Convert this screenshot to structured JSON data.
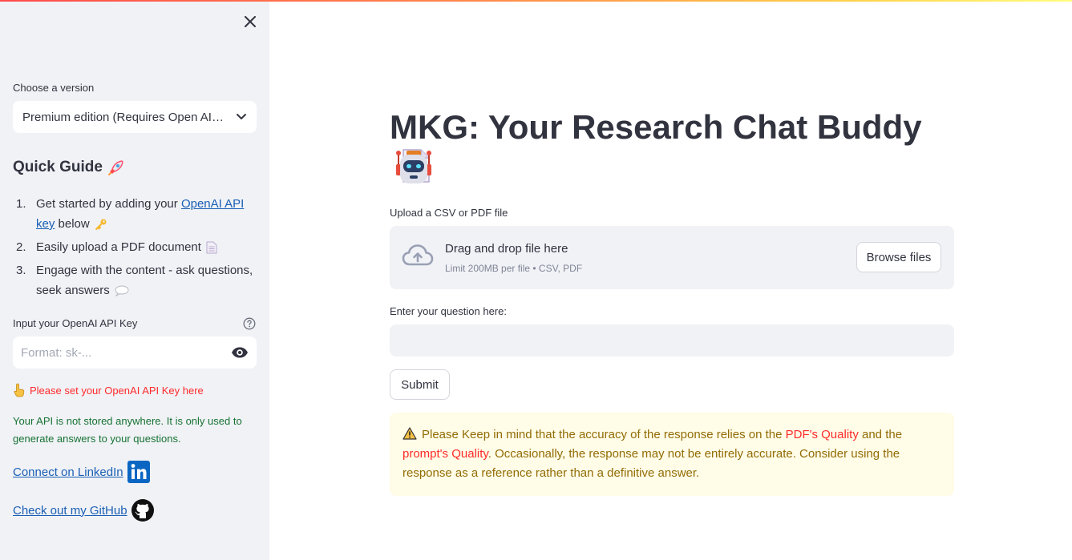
{
  "sidebar": {
    "version_label": "Choose a version",
    "version_selected": "Premium edition (Requires Open AI API)",
    "quick_guide_title": "Quick Guide",
    "guide": [
      {
        "num": "1.",
        "pre": "Get started by adding your ",
        "link": "OpenAI API key",
        "post": " below"
      },
      {
        "num": "2.",
        "text": "Easily upload a PDF document"
      },
      {
        "num": "3.",
        "text": "Engage with the content - ask questions, seek answers"
      }
    ],
    "api_label": "Input your OpenAI API Key",
    "api_placeholder": "Format: sk-...",
    "api_warning": "Please set your OpenAI API Key here",
    "api_info": "Your API is not stored anywhere. It is only used to generate answers to your questions.",
    "linkedin_text": "Connect on LinkedIn",
    "github_text": "Check out my GitHub"
  },
  "main": {
    "title": "MKG: Your Research Chat Buddy",
    "upload_label": "Upload a CSV or PDF file",
    "dropzone_text": "Drag and drop file here",
    "dropzone_limit": "Limit 200MB per file • CSV, PDF",
    "browse_label": "Browse files",
    "question_label": "Enter your question here:",
    "question_value": "",
    "submit_label": "Submit",
    "alert": {
      "part1": "Please Keep in mind that the accuracy of the response relies on the ",
      "red1": "PDF's Quality",
      "part2": " and the ",
      "red2": "prompt's Quality",
      "part3": ". Occasionally, the response may not be entirely accurate. Consider using the response as a reference rather than a definitive answer."
    }
  },
  "colors": {
    "sidebar_bg": "#f0f2f6",
    "text": "#31333f",
    "link": "#1a5fb4",
    "error": "#ff2b2b",
    "success": "#177233",
    "warning_bg": "#fffce7",
    "warning_text": "#926c05"
  }
}
